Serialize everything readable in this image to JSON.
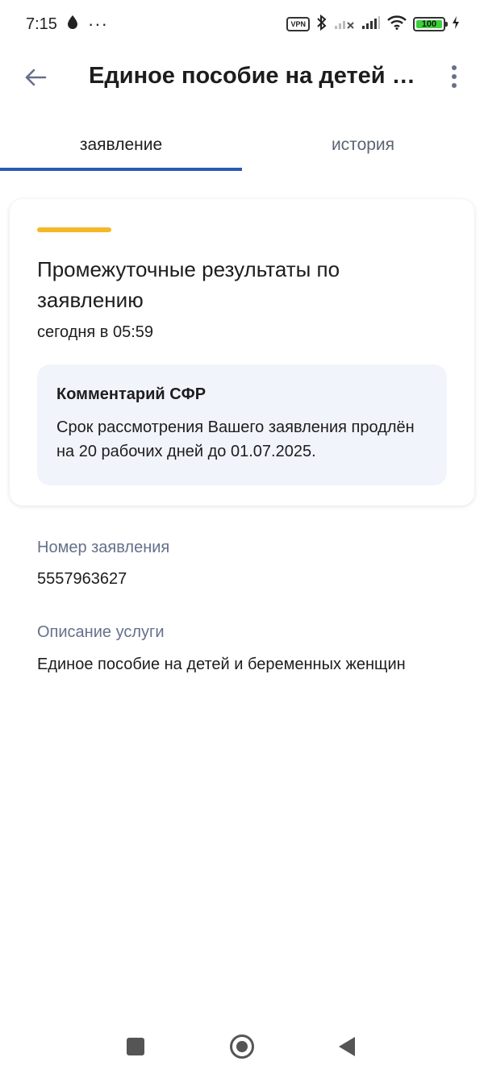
{
  "status_bar": {
    "time": "7:15",
    "dots": "···",
    "vpn": "VPN",
    "battery": "100"
  },
  "header": {
    "title": "Единое пособие на детей и беременных женщин"
  },
  "tabs": [
    {
      "label": "заявление",
      "active": true
    },
    {
      "label": "история",
      "active": false
    }
  ],
  "card": {
    "title": "Промежуточные результаты по заявлению",
    "time": "сегодня в 05:59",
    "comment": {
      "title": "Комментарий СФР",
      "text": "Срок рассмотрения Вашего заявления продлён на 20 рабочих дней до 01.07.2025."
    }
  },
  "info": {
    "number_label": "Номер заявления",
    "number_value": "5557963627",
    "description_label": "Описание услуги",
    "description_value": "Единое пособие на детей и беременных женщин"
  },
  "colors": {
    "accent_yellow": "#f5b829",
    "tab_underline": "#2b5bb3",
    "comment_bg": "#f1f4fa",
    "label_gray": "#65708a"
  }
}
